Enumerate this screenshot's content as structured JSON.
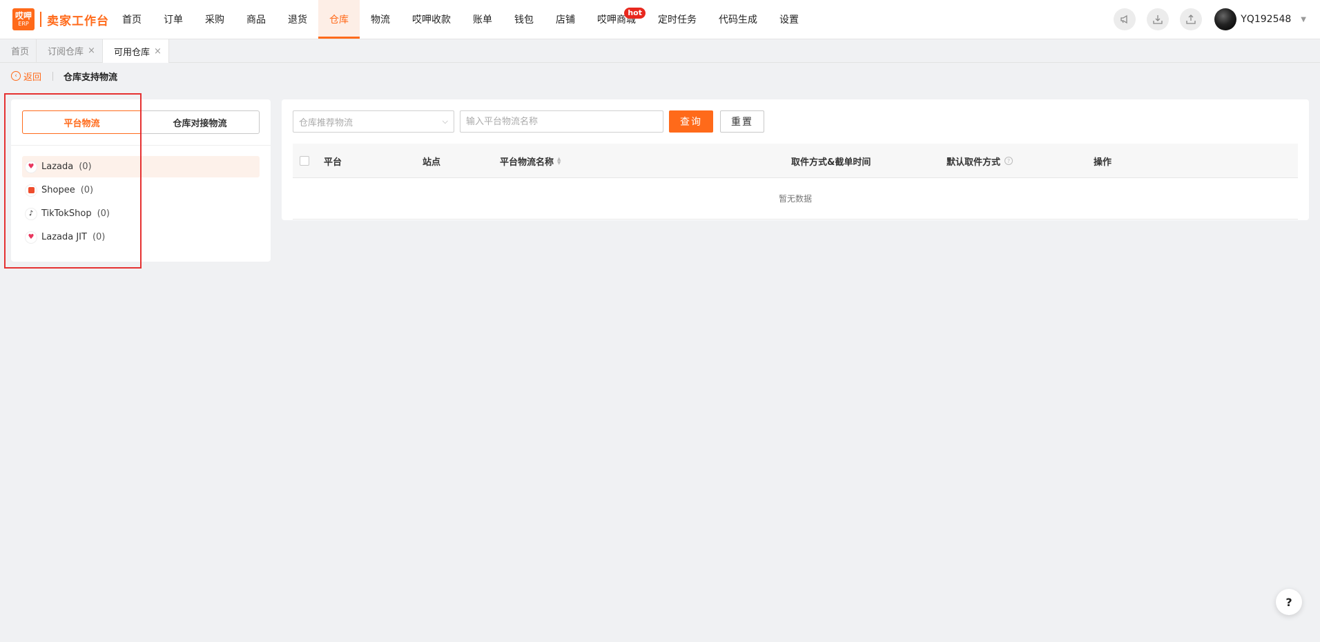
{
  "app": {
    "logo_top": "哎呷",
    "logo_bottom": "ERP",
    "title": "卖家工作台"
  },
  "nav": {
    "items": [
      {
        "label": "首页"
      },
      {
        "label": "订单"
      },
      {
        "label": "采购"
      },
      {
        "label": "商品"
      },
      {
        "label": "退货"
      },
      {
        "label": "仓库"
      },
      {
        "label": "物流"
      },
      {
        "label": "哎呷收款"
      },
      {
        "label": "账单"
      },
      {
        "label": "钱包"
      },
      {
        "label": "店铺"
      },
      {
        "label": "哎呷商城"
      },
      {
        "label": "定时任务"
      },
      {
        "label": "代码生成"
      },
      {
        "label": "设置"
      }
    ],
    "active_index": 5,
    "hot_badge": "hot"
  },
  "user": {
    "name": "YQ192548"
  },
  "tabs": [
    {
      "label": "首页"
    },
    {
      "label": "订阅仓库"
    },
    {
      "label": "可用仓库"
    }
  ],
  "breadcrumb": {
    "back": "返回",
    "title": "仓库支持物流"
  },
  "left": {
    "segments": [
      "平台物流",
      "仓库对接物流"
    ],
    "platforms": [
      {
        "name": "Lazada",
        "count": "(0)"
      },
      {
        "name": "Shopee",
        "count": "(0)"
      },
      {
        "name": "TikTokShop",
        "count": "(0)"
      },
      {
        "name": "Lazada JIT",
        "count": "(0)"
      }
    ]
  },
  "filters": {
    "select_placeholder": "仓库推荐物流",
    "input_placeholder": "输入平台物流名称",
    "query": "查询",
    "reset": "重置"
  },
  "table": {
    "columns": [
      "平台",
      "站点",
      "平台物流名称",
      "取件方式&截单时间",
      "默认取件方式",
      "操作"
    ],
    "empty_text": "暂无数据"
  },
  "help_button": "?",
  "colors": {
    "accent": "#ff6a1a",
    "highlight_box": "#e53030",
    "hot": "#e8281e"
  }
}
